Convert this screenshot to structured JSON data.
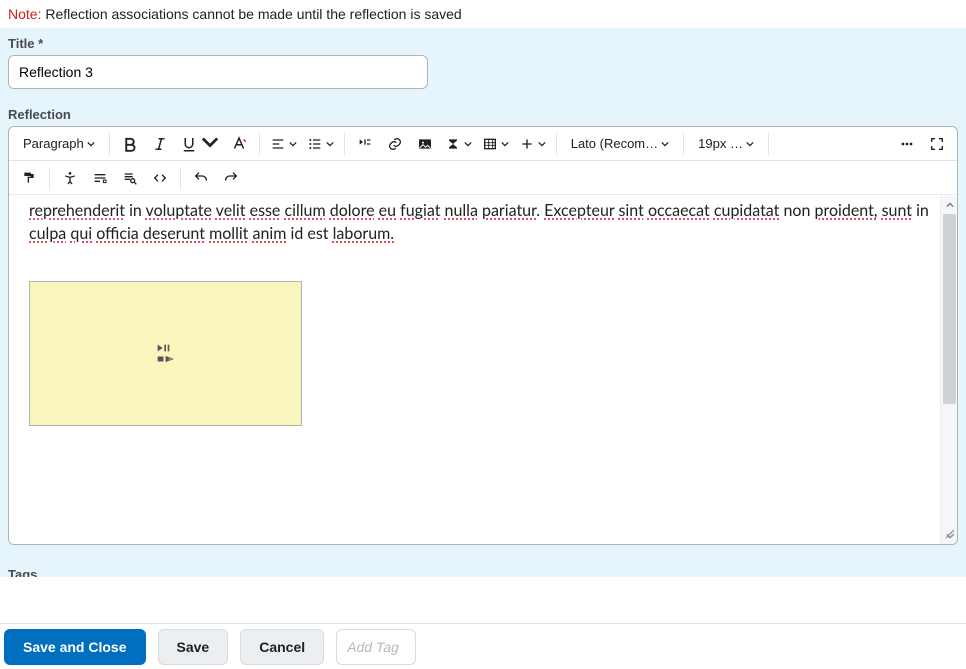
{
  "note": {
    "prefix": "Note:",
    "text": "Reflection associations cannot be made until the reflection is saved"
  },
  "title": {
    "label": "Title *",
    "value": "Reflection 3"
  },
  "reflection": {
    "label": "Reflection"
  },
  "toolbar": {
    "block": "Paragraph",
    "font": "Lato (Recom…",
    "size": "19px …"
  },
  "editor": {
    "line1_plain1": " in ",
    "line1_plain2": " non ",
    "line1_plain3": " in ",
    "w_reprehenderit": "reprehenderit",
    "w_voluptate": "voluptate",
    "w_velit": "velit",
    "w_esse": "esse",
    "w_cillum": "cillum",
    "w_dolore": "dolore",
    "w_eu": "eu",
    "w_fugiat": "fugiat",
    "w_nulla": "nulla",
    "w_pariatur": "pariatur",
    "w_excepteur": "Excepteur",
    "w_sint": "sint",
    "w_occaecat": "occaecat",
    "w_cupidatat": "cupidatat",
    "w_proident": "proident,",
    "w_sunt": "sunt",
    "w_culpa": "culpa",
    "w_qui": "qui",
    "w_officia": "officia",
    "w_deserunt": "deserunt",
    "w_mollit": "mollit",
    "w_anim": "anim",
    "line2_tail": " id est ",
    "w_laborum": "laborum."
  },
  "tags": {
    "label": "Tags"
  },
  "footer": {
    "save_close": "Save and Close",
    "save": "Save",
    "cancel": "Cancel",
    "add_tag_placeholder": "Add Tag"
  }
}
